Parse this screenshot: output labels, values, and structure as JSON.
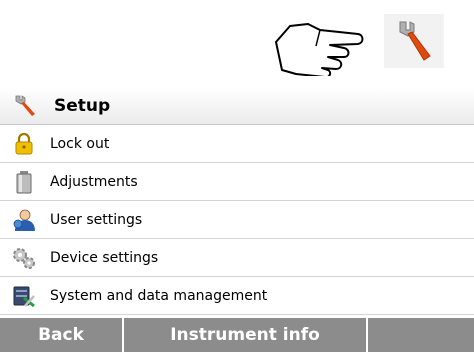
{
  "top": {
    "hand_icon": "pointing-hand-icon",
    "wrench_icon": "wrench-icon"
  },
  "menu": {
    "title": "Setup",
    "title_icon": "wrench-icon",
    "items": [
      {
        "label": "Lock out",
        "icon": "padlock-icon"
      },
      {
        "label": "Adjustments",
        "icon": "weight-icon"
      },
      {
        "label": "User settings",
        "icon": "user-icon"
      },
      {
        "label": "Device settings",
        "icon": "gears-icon"
      },
      {
        "label": "System and data management",
        "icon": "database-tools-icon"
      }
    ]
  },
  "bottom_bar": {
    "back_label": "Back",
    "instrument_info_label": "Instrument info",
    "empty_label": ""
  },
  "colors": {
    "wrench_handle": "#e04a10",
    "bottom_bar": "#8c8c8c",
    "padlock": "#e0a800"
  }
}
